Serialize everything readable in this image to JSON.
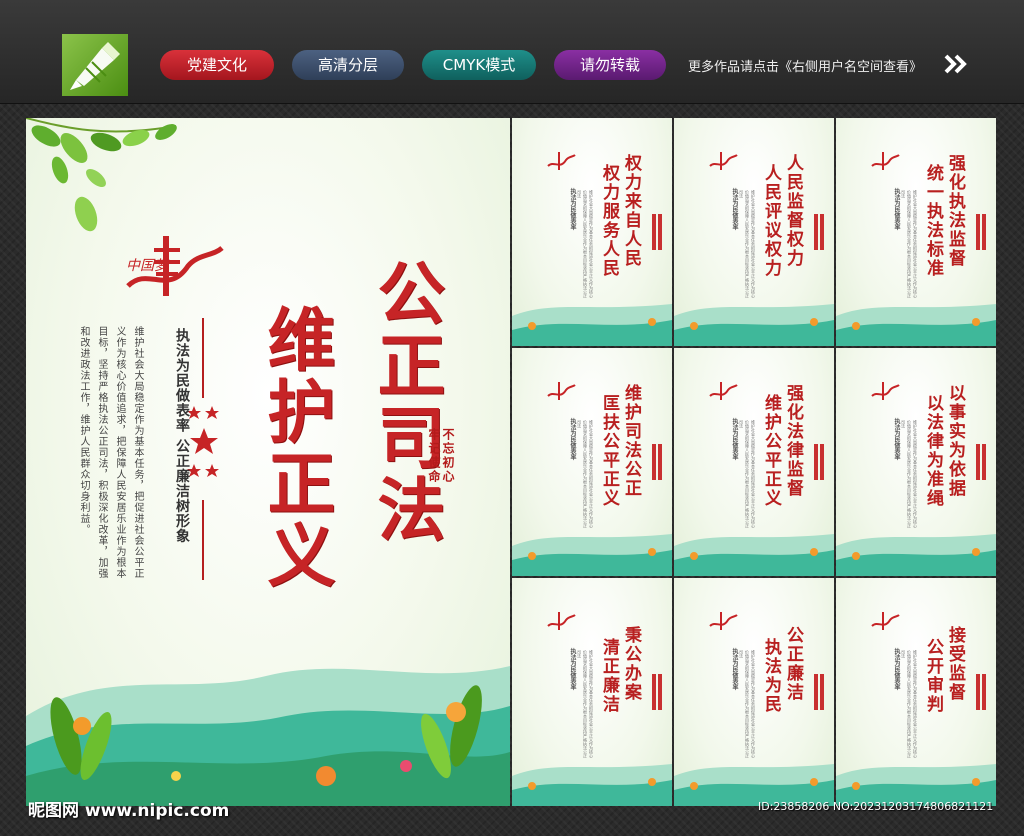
{
  "header": {
    "tags": [
      "党建文化",
      "高清分层",
      "CMYK模式",
      "请勿转载"
    ],
    "more_link": "更多作品请点击《右侧用户名空间查看》"
  },
  "main_poster": {
    "title_line_1": "公正司法",
    "title_line_2": "维护正义",
    "seal_line_1": "不忘初心",
    "seal_line_2": "牢记使命",
    "subtitle": "执法为民做表率  公正廉洁树形象",
    "body": "维护社会大局稳定作为基本任务，把促进社会公平正义作为核心价值追求，把保障人民安居乐业作为根本目标，坚持严格执法公正司法，积极深化改革，加强和改进政法工作，维护人民群众切身利益。",
    "logo_text": "中国梦"
  },
  "small_posters": [
    {
      "line_1": "权力来自人民",
      "line_2": "权力服务人民"
    },
    {
      "line_1": "人民监督权力",
      "line_2": "人民评议权力"
    },
    {
      "line_1": "强化执法监督",
      "line_2": "统一执法标准"
    },
    {
      "line_1": "维护司法公正",
      "line_2": "匡扶公平正义"
    },
    {
      "line_1": "强化法律监督",
      "line_2": "维护公平正义"
    },
    {
      "line_1": "以事实为依据",
      "line_2": "以法律为准绳"
    },
    {
      "line_1": "秉公办案",
      "line_2": "清正廉洁"
    },
    {
      "line_1": "公正廉洁",
      "line_2": "执法为民"
    },
    {
      "line_1": "接受监督",
      "line_2": "公开审判"
    }
  ],
  "small_body": "维护社会大局稳定作为基本任务把促进社会公平正义作为核心价值追求把保障人民安居乐业作为根本目标坚持严格执法公正司法",
  "small_subtitle": "执法为民做表率",
  "watermark": {
    "site": "昵图网 www.nipic.com",
    "id": "ID:23858206 NO:20231203174806821121"
  },
  "colors": {
    "title_red": "#c62426",
    "leaf_green": "#5fae2e",
    "hill_green": "#3fb89a"
  }
}
